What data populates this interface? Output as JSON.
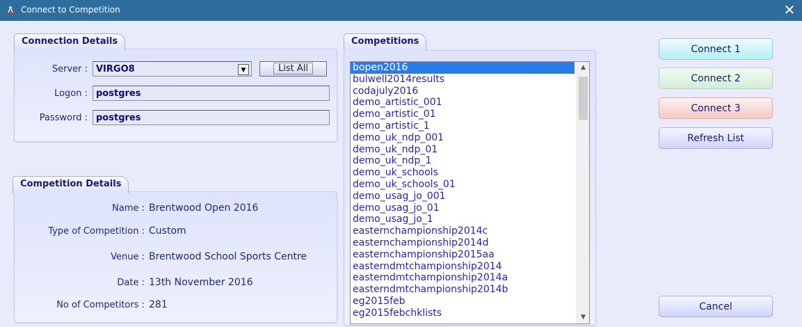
{
  "window": {
    "title": "Connect to Competition",
    "close_glyph": "✕"
  },
  "connection": {
    "tab": "Connection Details",
    "server_label": "Server :",
    "server_value": "VIRGO8",
    "list_all": "List All",
    "logon_label": "Logon :",
    "logon_value": "postgres",
    "password_label": "Password :",
    "password_value": "postgres"
  },
  "competition": {
    "tab": "Competition Details",
    "name_label": "Name :",
    "name_value": "Brentwood Open 2016",
    "type_label": "Type of Competition :",
    "type_value": "Custom",
    "venue_label": "Venue :",
    "venue_value": "Brentwood School Sports Centre",
    "date_label": "Date :",
    "date_value": "13th November 2016",
    "count_label": "No of Competitors :",
    "count_value": "281"
  },
  "competitions": {
    "tab": "Competitions",
    "selected": "bopen2016",
    "items": [
      "bopen2016",
      "bulwell2014results",
      "codajuly2016",
      "demo_artistic_001",
      "demo_artistic_01",
      "demo_artistic_1",
      "demo_uk_ndp_001",
      "demo_uk_ndp_01",
      "demo_uk_ndp_1",
      "demo_uk_schools",
      "demo_uk_schools_01",
      "demo_usag_jo_001",
      "demo_usag_jo_01",
      "demo_usag_jo_1",
      "easternchampionship2014c",
      "easternchampionship2014d",
      "easternchampionship2015aa",
      "easterndmtchampionship2014",
      "easterndmtchampionship2014a",
      "easterndmtchampionship2014b",
      "eg2015feb",
      "eg2015febchklists"
    ]
  },
  "buttons": {
    "connect1": "Connect 1",
    "connect2": "Connect 2",
    "connect3": "Connect 3",
    "refresh": "Refresh List",
    "cancel": "Cancel"
  },
  "colors": {
    "titlebar": "#2e6e9f",
    "selection": "#2a7de4",
    "background": "#e9ebfa"
  },
  "icons": {
    "app": "gymnast-icon",
    "close": "close-icon",
    "dropdown": "chevron-down-icon"
  }
}
